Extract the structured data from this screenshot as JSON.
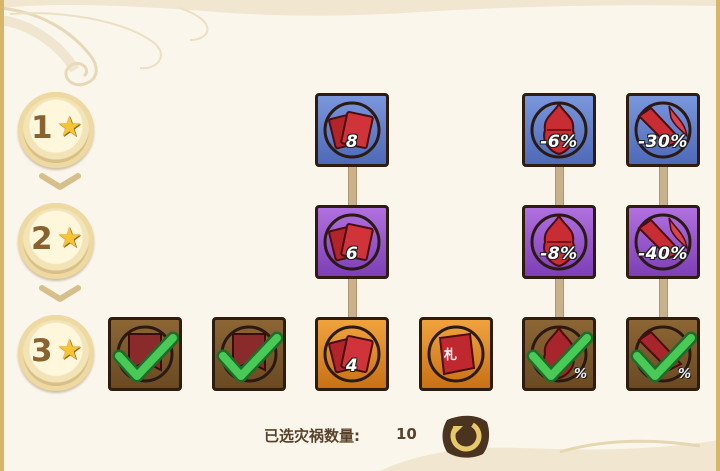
{
  "tiers": [
    {
      "number": "1",
      "icon": "star-icon"
    },
    {
      "number": "2",
      "icon": "star-icon"
    },
    {
      "number": "3",
      "icon": "star-icon"
    }
  ],
  "cards": {
    "row1": [
      {
        "value": "8",
        "color": "blue",
        "icon": "scroll-icon"
      },
      {
        "value": "-6%",
        "color": "blue",
        "icon": "flame-heart-icon"
      },
      {
        "value": "-30%",
        "color": "blue",
        "icon": "blade-icon"
      }
    ],
    "row2": [
      {
        "value": "6",
        "color": "purple",
        "icon": "scroll-icon"
      },
      {
        "value": "-8%",
        "color": "purple",
        "icon": "flame-heart-icon"
      },
      {
        "value": "-40%",
        "color": "purple",
        "icon": "blade-icon"
      }
    ],
    "row3": [
      {
        "value": "",
        "color": "selected",
        "icon": "talisman-icon",
        "checked": true
      },
      {
        "value": "",
        "color": "selected",
        "icon": "talisman-icon",
        "checked": true
      },
      {
        "value": "4",
        "color": "orange",
        "icon": "scroll-icon",
        "checked": false
      },
      {
        "value": "",
        "color": "orange",
        "icon": "seal-icon",
        "glyph": "札",
        "checked": false
      },
      {
        "value": "%",
        "color": "selected",
        "icon": "flame-heart-icon",
        "checked": true
      },
      {
        "value": "%",
        "color": "selected",
        "icon": "blade-icon",
        "checked": true
      }
    ]
  },
  "footer": {
    "label": "已选灾祸数量:",
    "count": "10",
    "reset_icon": "refresh-icon"
  },
  "colors": {
    "background": "#faf6ec",
    "border": "#cfae63",
    "card_blue": "#5d78c4",
    "card_purple": "#9450c8",
    "card_orange": "#e08a2a",
    "check_green": "#3fbf4a"
  }
}
